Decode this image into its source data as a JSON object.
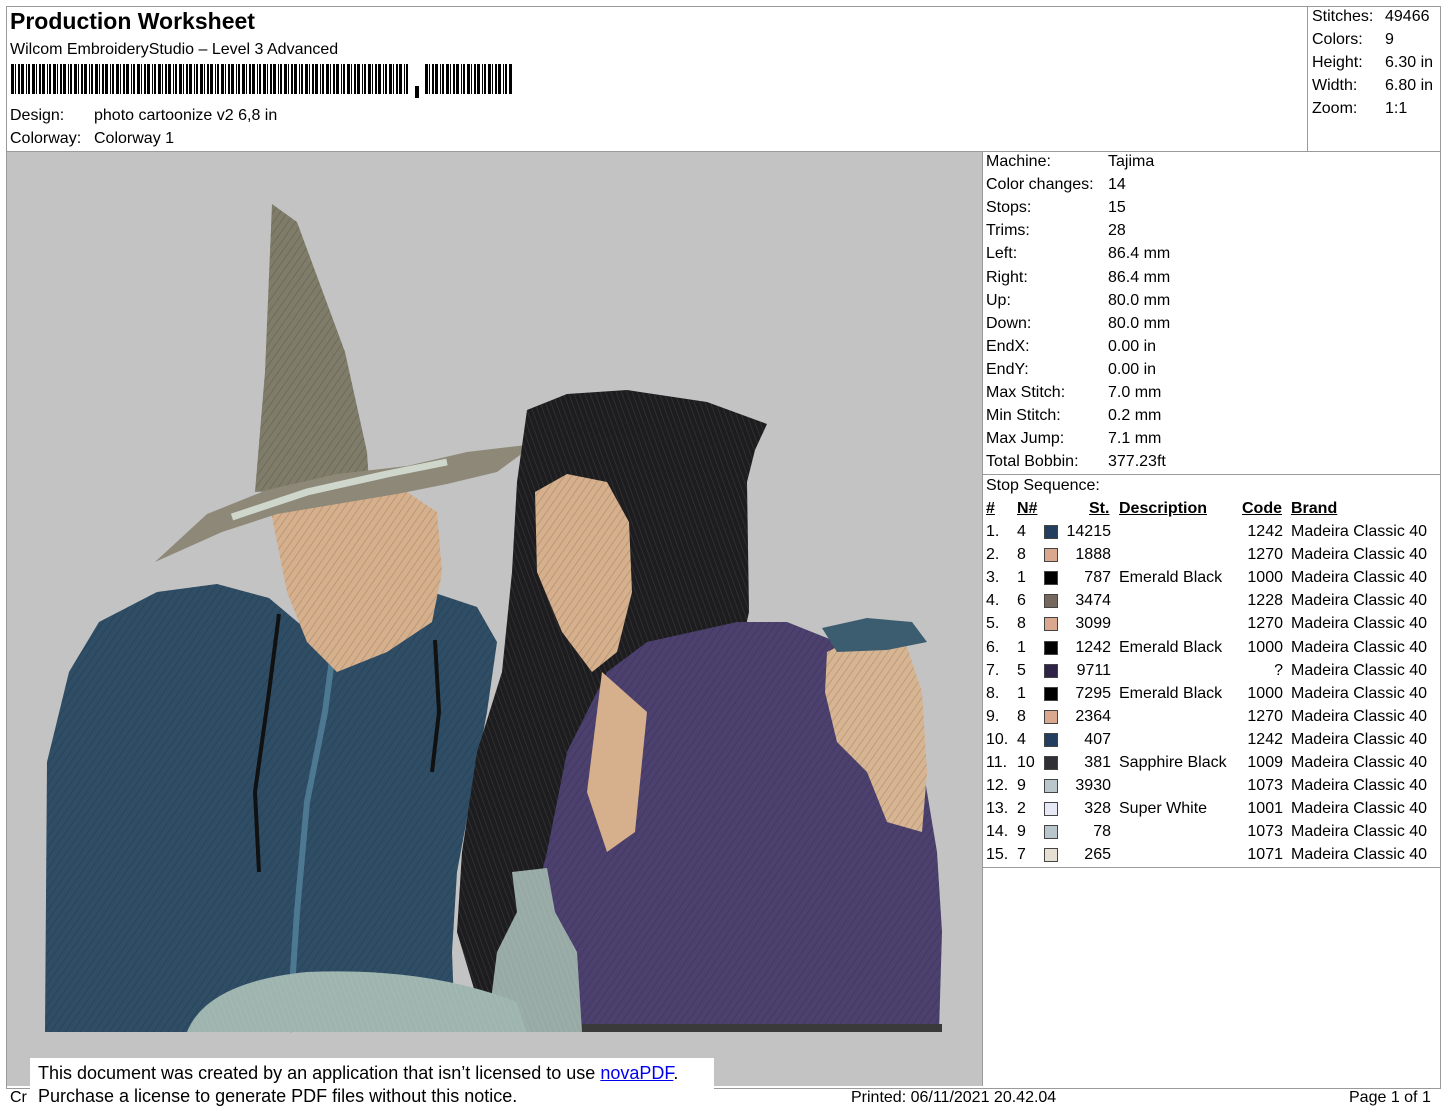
{
  "header": {
    "title": "Production Worksheet",
    "subtitle": "Wilcom EmbroideryStudio – Level 3 Advanced",
    "design_label": "Design:",
    "design_value": "photo cartoonize v2 6,8 in",
    "colorway_label": "Colorway:",
    "colorway_value": "Colorway 1"
  },
  "stats": [
    {
      "label": "Stitches:",
      "value": "49466"
    },
    {
      "label": "Colors:",
      "value": "9"
    },
    {
      "label": "Height:",
      "value": "6.30 in"
    },
    {
      "label": "Width:",
      "value": "6.80 in"
    },
    {
      "label": "Zoom:",
      "value": "1:1"
    }
  ],
  "machine_info": [
    {
      "label": "Machine:",
      "value": "Tajima"
    },
    {
      "label": "Color changes:",
      "value": "14"
    },
    {
      "label": "Stops:",
      "value": "15"
    },
    {
      "label": "Trims:",
      "value": "28"
    },
    {
      "label": "Left:",
      "value": "86.4 mm"
    },
    {
      "label": "Right:",
      "value": "86.4 mm"
    },
    {
      "label": "Up:",
      "value": "80.0 mm"
    },
    {
      "label": "Down:",
      "value": "80.0 mm"
    },
    {
      "label": "EndX:",
      "value": "0.00 in"
    },
    {
      "label": "EndY:",
      "value": "0.00 in"
    },
    {
      "label": "Max Stitch:",
      "value": "7.0 mm"
    },
    {
      "label": "Min Stitch:",
      "value": "0.2 mm"
    },
    {
      "label": "Max Jump:",
      "value": "7.1 mm"
    },
    {
      "label": "Total Bobbin:",
      "value": "377.23ft"
    }
  ],
  "stop_sequence": {
    "title": "Stop Sequence:",
    "headers": {
      "num": "#",
      "n": "N#",
      "st": "St.",
      "desc": "Description",
      "code": "Code",
      "brand": "Brand"
    },
    "rows": [
      {
        "num": "1.",
        "n": "4",
        "color": "#233f5e",
        "st": "14215",
        "desc": "",
        "code": "1242",
        "brand": "Madeira Classic 40"
      },
      {
        "num": "2.",
        "n": "8",
        "color": "#d9a88f",
        "st": "1888",
        "desc": "",
        "code": "1270",
        "brand": "Madeira Classic 40"
      },
      {
        "num": "3.",
        "n": "1",
        "color": "#000000",
        "st": "787",
        "desc": "Emerald Black",
        "code": "1000",
        "brand": "Madeira Classic 40"
      },
      {
        "num": "4.",
        "n": "6",
        "color": "#76685d",
        "st": "3474",
        "desc": "",
        "code": "1228",
        "brand": "Madeira Classic 40"
      },
      {
        "num": "5.",
        "n": "8",
        "color": "#d9a88f",
        "st": "3099",
        "desc": "",
        "code": "1270",
        "brand": "Madeira Classic 40"
      },
      {
        "num": "6.",
        "n": "1",
        "color": "#000000",
        "st": "1242",
        "desc": "Emerald Black",
        "code": "1000",
        "brand": "Madeira Classic 40"
      },
      {
        "num": "7.",
        "n": "5",
        "color": "#2e2247",
        "st": "9711",
        "desc": "",
        "code": "?",
        "brand": "Madeira Classic 40"
      },
      {
        "num": "8.",
        "n": "1",
        "color": "#000000",
        "st": "7295",
        "desc": "Emerald Black",
        "code": "1000",
        "brand": "Madeira Classic 40"
      },
      {
        "num": "9.",
        "n": "8",
        "color": "#d9a88f",
        "st": "2364",
        "desc": "",
        "code": "1270",
        "brand": "Madeira Classic 40"
      },
      {
        "num": "10.",
        "n": "4",
        "color": "#233f5e",
        "st": "407",
        "desc": "",
        "code": "1242",
        "brand": "Madeira Classic 40"
      },
      {
        "num": "11.",
        "n": "10",
        "color": "#2f2f35",
        "st": "381",
        "desc": "Sapphire Black",
        "code": "1009",
        "brand": "Madeira Classic 40"
      },
      {
        "num": "12.",
        "n": "9",
        "color": "#b9c7cc",
        "st": "3930",
        "desc": "",
        "code": "1073",
        "brand": "Madeira Classic 40"
      },
      {
        "num": "13.",
        "n": "2",
        "color": "#e6e8f5",
        "st": "328",
        "desc": "Super White",
        "code": "1001",
        "brand": "Madeira Classic 40"
      },
      {
        "num": "14.",
        "n": "9",
        "color": "#b9c7cc",
        "st": "78",
        "desc": "",
        "code": "1073",
        "brand": "Madeira Classic 40"
      },
      {
        "num": "15.",
        "n": "7",
        "color": "#e6e0d2",
        "st": "265",
        "desc": "",
        "code": "1071",
        "brand": "Madeira Classic 40"
      }
    ]
  },
  "footer": {
    "notice_line1_prefix": "This document was created by an application that isn’t licensed to use ",
    "notice_link": "novaPDF",
    "notice_line1_suffix": ".",
    "notice_line2": "Purchase a license to generate PDF files without this notice.",
    "cr_text": "Cr",
    "printed": "Printed: 06/11/2021 20.42.04",
    "page": "Page 1 of 1"
  }
}
